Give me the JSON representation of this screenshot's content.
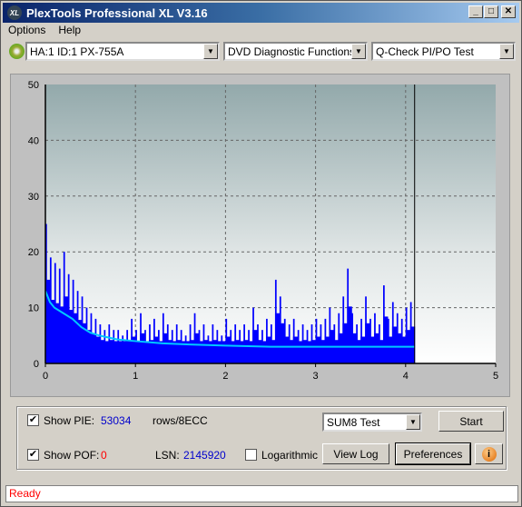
{
  "window": {
    "title": "PlexTools Professional XL V3.16",
    "logo": "XL"
  },
  "menu": [
    "Options",
    "Help"
  ],
  "toolbar": {
    "drive": "HA:1 ID:1  PX-755A",
    "function": "DVD Diagnostic Functions",
    "test": "Q-Check PI/PO Test"
  },
  "controls": {
    "show_pie_label": "Show PIE:",
    "pie_value": "53034",
    "pie_unit": "rows/8ECC",
    "show_pof_label": "Show POF:",
    "pof_value": "0",
    "lsn_label": "LSN:",
    "lsn_value": "2145920",
    "logarithmic_label": "Logarithmic",
    "show_pie_checked": true,
    "show_pof_checked": true,
    "logarithmic_checked": false,
    "test_mode": "SUM8 Test",
    "start": "Start",
    "view_log": "View Log",
    "preferences": "Preferences",
    "info_icon": "info-icon"
  },
  "status": "Ready",
  "chart_data": {
    "type": "bar",
    "xlim": [
      0,
      5
    ],
    "ylim": [
      0,
      50
    ],
    "xticks": [
      "0",
      "1",
      "2",
      "3",
      "4",
      "5"
    ],
    "yticks": [
      "0",
      "10",
      "20",
      "30",
      "40",
      "50"
    ],
    "grid": true,
    "end_marker_x": 4.1,
    "colors": {
      "bars": "#0000ff",
      "average": "#00c8ff"
    },
    "x": [
      0,
      0.05,
      0.1,
      0.15,
      0.2,
      0.25,
      0.3,
      0.35,
      0.4,
      0.45,
      0.5,
      0.55,
      0.6,
      0.65,
      0.7,
      0.75,
      0.8,
      0.85,
      0.9,
      0.95,
      1,
      1.05,
      1.1,
      1.15,
      1.2,
      1.25,
      1.3,
      1.35,
      1.4,
      1.45,
      1.5,
      1.55,
      1.6,
      1.65,
      1.7,
      1.75,
      1.8,
      1.85,
      1.9,
      1.95,
      2,
      2.05,
      2.1,
      2.15,
      2.2,
      2.25,
      2.3,
      2.35,
      2.4,
      2.45,
      2.5,
      2.55,
      2.6,
      2.65,
      2.7,
      2.75,
      2.8,
      2.85,
      2.9,
      2.95,
      3,
      3.05,
      3.1,
      3.15,
      3.2,
      3.25,
      3.3,
      3.35,
      3.4,
      3.45,
      3.5,
      3.55,
      3.6,
      3.65,
      3.7,
      3.75,
      3.8,
      3.85,
      3.9,
      3.95,
      4,
      4.05
    ],
    "pie_max": [
      25,
      19,
      18,
      17,
      20,
      16,
      15,
      13,
      12,
      10,
      9,
      8,
      7,
      6,
      7,
      6,
      6,
      5,
      6,
      8,
      6,
      9,
      6,
      7,
      8,
      6,
      9,
      7,
      6,
      7,
      6,
      5,
      7,
      9,
      6,
      7,
      5,
      7,
      6,
      5,
      8,
      6,
      7,
      6,
      7,
      6,
      10,
      7,
      6,
      8,
      7,
      15,
      12,
      8,
      7,
      8,
      6,
      7,
      6,
      7,
      8,
      7,
      8,
      10,
      7,
      9,
      12,
      17,
      9,
      7,
      8,
      12,
      8,
      9,
      7,
      14,
      8,
      11,
      9,
      8,
      10,
      11
    ],
    "pie_average": [
      [
        0,
        13
      ],
      [
        0.05,
        11
      ],
      [
        0.1,
        10
      ],
      [
        0.2,
        9
      ],
      [
        0.3,
        8
      ],
      [
        0.4,
        6.5
      ],
      [
        0.5,
        5.5
      ],
      [
        0.6,
        5
      ],
      [
        0.8,
        4.3
      ],
      [
        1,
        4
      ],
      [
        1.3,
        3.6
      ],
      [
        1.6,
        3.4
      ],
      [
        2,
        3.2
      ],
      [
        2.5,
        3
      ],
      [
        4.1,
        3
      ]
    ]
  }
}
